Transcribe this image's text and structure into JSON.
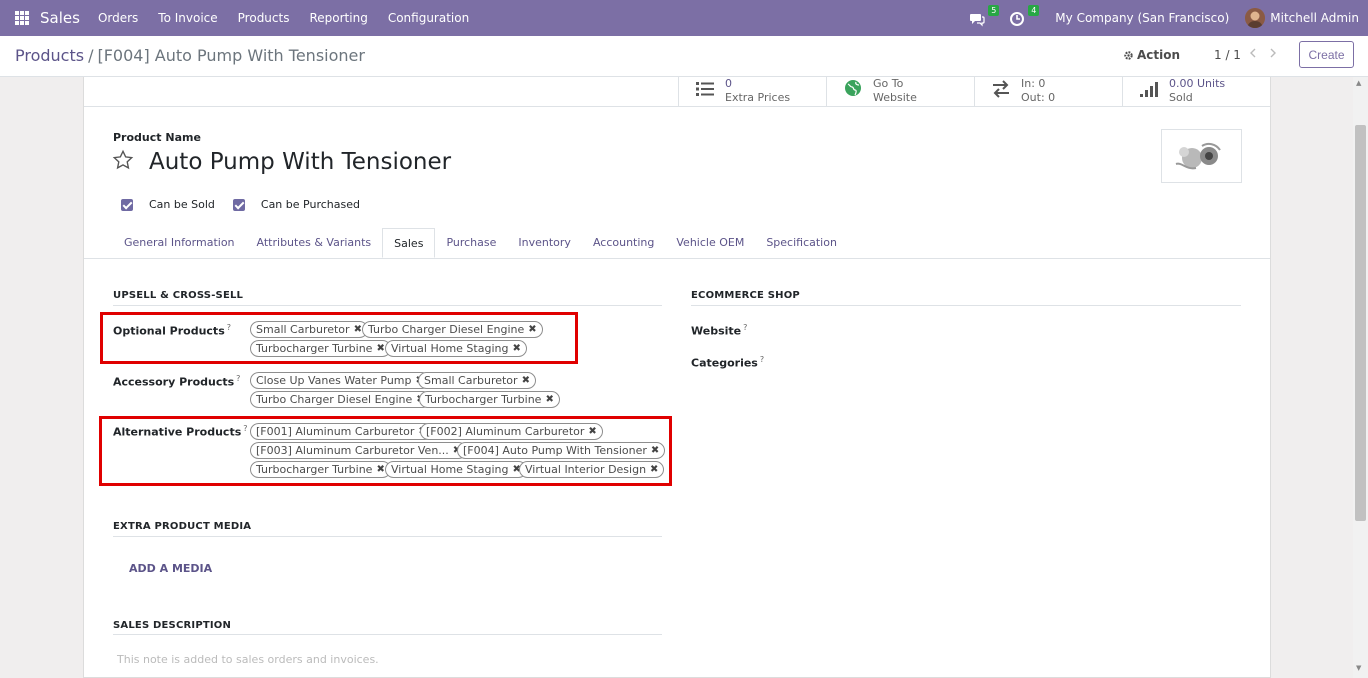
{
  "navbar": {
    "brand": "Sales",
    "menu": [
      "Orders",
      "To Invoice",
      "Products",
      "Reporting",
      "Configuration"
    ],
    "messages_count": "5",
    "activities_count": "4",
    "company": "My Company (San Francisco)",
    "user": "Mitchell Admin"
  },
  "control_panel": {
    "breadcrumb_root": "Products",
    "breadcrumb_sep": "/",
    "breadcrumb_current": "[F004] Auto Pump With Tensioner",
    "action_label": "Action",
    "pager": "1 / 1",
    "create_label": "Create"
  },
  "smart_buttons": [
    {
      "value": "0",
      "label": "Extra Prices",
      "icon": "list-icon"
    },
    {
      "value": "Go To",
      "label": "Website",
      "icon": "globe-icon"
    },
    {
      "value": "In:  0",
      "label": "Out:  0",
      "icon": "transfer-icon"
    },
    {
      "value": "0.00 Units",
      "label": "Sold",
      "icon": "signal-icon"
    }
  ],
  "product": {
    "name_label": "Product Name",
    "name": "Auto Pump With Tensioner",
    "can_be_sold_label": "Can be Sold",
    "can_be_purchased_label": "Can be Purchased"
  },
  "tabs": [
    "General Information",
    "Attributes & Variants",
    "Sales",
    "Purchase",
    "Inventory",
    "Accounting",
    "Vehicle OEM",
    "Specification"
  ],
  "sales": {
    "upsell_title": "UPSELL & CROSS-SELL",
    "optional_label": "Optional Products",
    "optional_tags": [
      "Small Carburetor",
      "Turbo Charger Diesel Engine",
      "Turbocharger Turbine",
      "Virtual Home Staging"
    ],
    "accessory_label": "Accessory Products",
    "accessory_tags": [
      "Close Up Vanes Water Pump",
      "Small Carburetor",
      "Turbo Charger Diesel Engine",
      "Turbocharger Turbine"
    ],
    "alternative_label": "Alternative Products",
    "alternative_tags": [
      "[F001] Aluminum Carburetor",
      "[F002] Aluminum Carburetor",
      "[F003] Aluminum Carburetor Ven...",
      "[F004] Auto Pump With Tensioner",
      "Turbocharger Turbine",
      "Virtual Home Staging",
      "Virtual Interior Design"
    ],
    "media_title": "EXTRA PRODUCT MEDIA",
    "add_media_label": "ADD A MEDIA",
    "description_title": "SALES DESCRIPTION",
    "description_placeholder": "This note is added to sales orders and invoices.",
    "ecommerce_title": "ECOMMERCE SHOP",
    "website_label": "Website",
    "categories_label": "Categories",
    "help_marker": "?"
  },
  "colors": {
    "navbar": "#7c6fa5",
    "link": "#5c5489",
    "highlight": "#e00000"
  }
}
